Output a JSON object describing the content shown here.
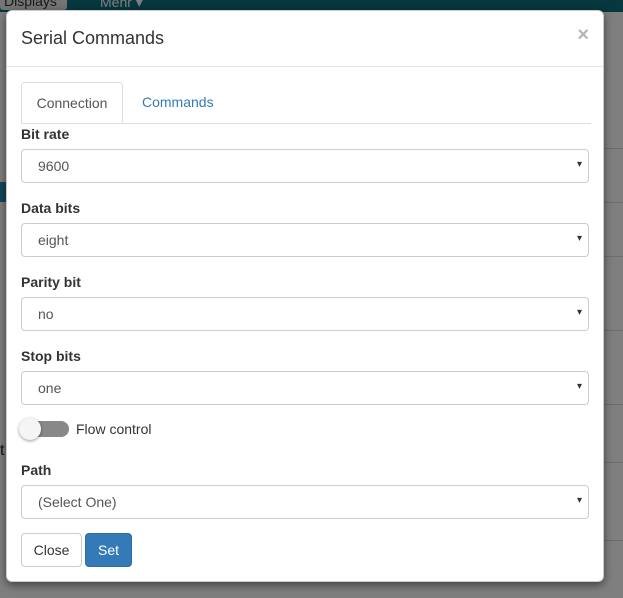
{
  "background": {
    "tab_displays": "Displays",
    "tab_mehr": "Mehr ▾"
  },
  "modal": {
    "title": "Serial Commands",
    "close_glyph": "×",
    "tabs": [
      {
        "label": "Connection",
        "active": true
      },
      {
        "label": "Commands",
        "active": false
      }
    ],
    "fields": {
      "bit_rate": {
        "label": "Bit rate",
        "value": "9600"
      },
      "data_bits": {
        "label": "Data bits",
        "value": "eight"
      },
      "parity_bit": {
        "label": "Parity bit",
        "value": "no"
      },
      "stop_bits": {
        "label": "Stop bits",
        "value": "one"
      },
      "path": {
        "label": "Path",
        "value": "(Select One)"
      }
    },
    "flow_control": {
      "label": "Flow control",
      "enabled": false
    },
    "arrow_glyph": "▾",
    "buttons": {
      "close": "Close",
      "set": "Set"
    }
  },
  "colors": {
    "accent": "#337ab7",
    "topbar": "#0e6f7e"
  }
}
